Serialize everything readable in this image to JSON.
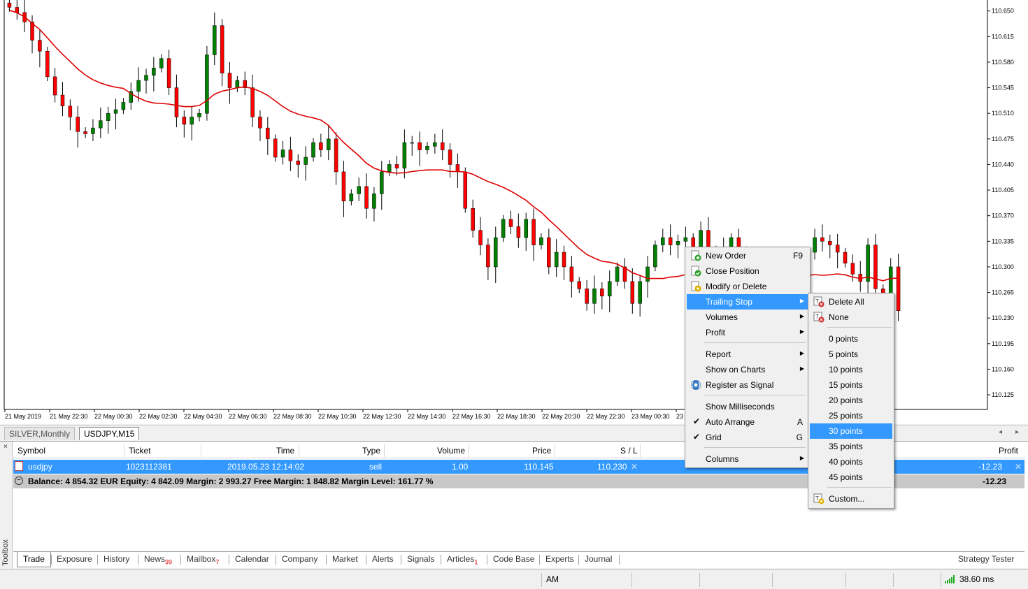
{
  "chart": {
    "price_labels": [
      "110.650",
      "110.615",
      "110.580",
      "110.545",
      "110.510",
      "110.475",
      "110.440",
      "110.405",
      "110.370",
      "110.335",
      "110.300",
      "110.265",
      "110.230",
      "110.195",
      "110.160",
      "110.125"
    ],
    "time_labels": [
      "21 May 2019",
      "21 May 22:30",
      "22 May 00:30",
      "22 May 02:30",
      "22 May 04:30",
      "22 May 06:30",
      "22 May 08:30",
      "22 May 10:30",
      "22 May 12:30",
      "22 May 14:30",
      "22 May 16:30",
      "22 May 18:30",
      "22 May 20:30",
      "22 May 22:30",
      "23 May 00:30",
      "23"
    ],
    "colors": {
      "bull": "#008000",
      "bear": "#ff0000",
      "ma": "#dd0000",
      "wick": "#000000"
    }
  },
  "chart_data": {
    "type": "candlestick",
    "symbol": "USDJPY",
    "timeframe": "M15",
    "ylim": [
      110.105,
      110.665
    ],
    "indicator": "moving average",
    "closes": [
      110.655,
      110.648,
      110.635,
      110.61,
      110.595,
      110.56,
      110.535,
      110.52,
      110.505,
      110.485,
      110.482,
      110.49,
      110.5,
      110.51,
      110.515,
      110.525,
      110.54,
      110.555,
      110.562,
      110.572,
      110.585,
      110.545,
      110.505,
      110.495,
      110.505,
      110.51,
      110.59,
      110.63,
      110.565,
      110.545,
      110.555,
      110.545,
      110.505,
      110.49,
      110.475,
      110.45,
      110.46,
      110.445,
      110.44,
      110.45,
      110.47,
      110.46,
      110.475,
      110.43,
      110.39,
      110.4,
      110.41,
      110.38,
      110.4,
      110.43,
      110.44,
      110.435,
      110.47,
      110.47,
      110.46,
      110.465,
      110.47,
      110.46,
      110.44,
      110.43,
      110.38,
      110.35,
      110.33,
      110.3,
      110.34,
      110.365,
      110.355,
      110.34,
      110.365,
      110.33,
      110.34,
      110.3,
      110.32,
      110.3,
      110.28,
      110.27,
      110.25,
      110.27,
      110.26,
      110.28,
      110.3,
      110.28,
      110.25,
      110.28,
      110.3,
      110.33,
      110.34,
      110.33,
      110.335,
      110.34,
      110.32,
      110.35,
      110.32,
      110.3,
      110.325,
      110.34,
      110.31,
      110.3,
      110.31,
      110.3,
      110.25,
      110.23,
      110.2,
      110.21,
      110.29,
      110.32,
      110.34,
      110.335,
      110.33,
      110.32,
      110.305,
      110.29,
      110.28,
      110.33,
      110.27,
      110.26,
      110.3,
      110.24
    ]
  },
  "chart_tabs": {
    "tab1": "SILVER,Monthly",
    "tab2": "USDJPY,M15",
    "arrow_left": "◂",
    "arrow_right": "▸"
  },
  "toolbox": {
    "label": "Toolbox",
    "close": "×",
    "headers": {
      "symbol": "Symbol",
      "ticket": "Ticket",
      "time": "Time",
      "type": "Type",
      "volume": "Volume",
      "price": "Price",
      "sl": "S / L",
      "profit": "Profit"
    },
    "trade": {
      "symbol": "usdjpy",
      "ticket": "1023112381",
      "time": "2019.05.23 12:14:02",
      "type": "sell",
      "volume": "1.00",
      "price": "110.145",
      "sl": "110.230",
      "profit": "-12.23"
    },
    "summary": {
      "text": "Balance: 4 854.32 EUR  Equity: 4 842.09  Margin: 2 993.27  Free Margin: 1 848.82  Margin Level: 161.77 %",
      "profit": "-12.23"
    },
    "tabs": [
      {
        "label": "Trade"
      },
      {
        "label": "Exposure"
      },
      {
        "label": "History"
      },
      {
        "label": "News",
        "badge": "99"
      },
      {
        "label": "Mailbox",
        "badge": "7"
      },
      {
        "label": "Calendar"
      },
      {
        "label": "Company"
      },
      {
        "label": "Market"
      },
      {
        "label": "Alerts"
      },
      {
        "label": "Signals"
      },
      {
        "label": "Articles",
        "badge": "1"
      },
      {
        "label": "Code Base"
      },
      {
        "label": "Experts"
      },
      {
        "label": "Journal"
      }
    ],
    "strategy_tester": "Strategy Tester"
  },
  "statusbar": {
    "mode": "AM",
    "ping": "38.60 ms",
    "signal_color": "#22aa22"
  },
  "context_menu": {
    "new_order": "New Order",
    "new_order_shortcut": "F9",
    "close_position": "Close Position",
    "modify_delete": "Modify or Delete",
    "trailing_stop": "Trailing Stop",
    "volumes": "Volumes",
    "profit": "Profit",
    "report": "Report",
    "show_on_charts": "Show on Charts",
    "register_signal": "Register as Signal",
    "show_ms": "Show Milliseconds",
    "auto_arrange": "Auto Arrange",
    "auto_arrange_shortcut": "A",
    "grid": "Grid",
    "grid_shortcut": "G",
    "columns": "Columns"
  },
  "submenu": {
    "delete_all": "Delete All",
    "none": "None",
    "points": [
      "0 points",
      "5 points",
      "10 points",
      "15 points",
      "20 points",
      "25 points",
      "30 points",
      "35 points",
      "40 points",
      "45 points"
    ],
    "selected": "30 points",
    "custom": "Custom..."
  }
}
